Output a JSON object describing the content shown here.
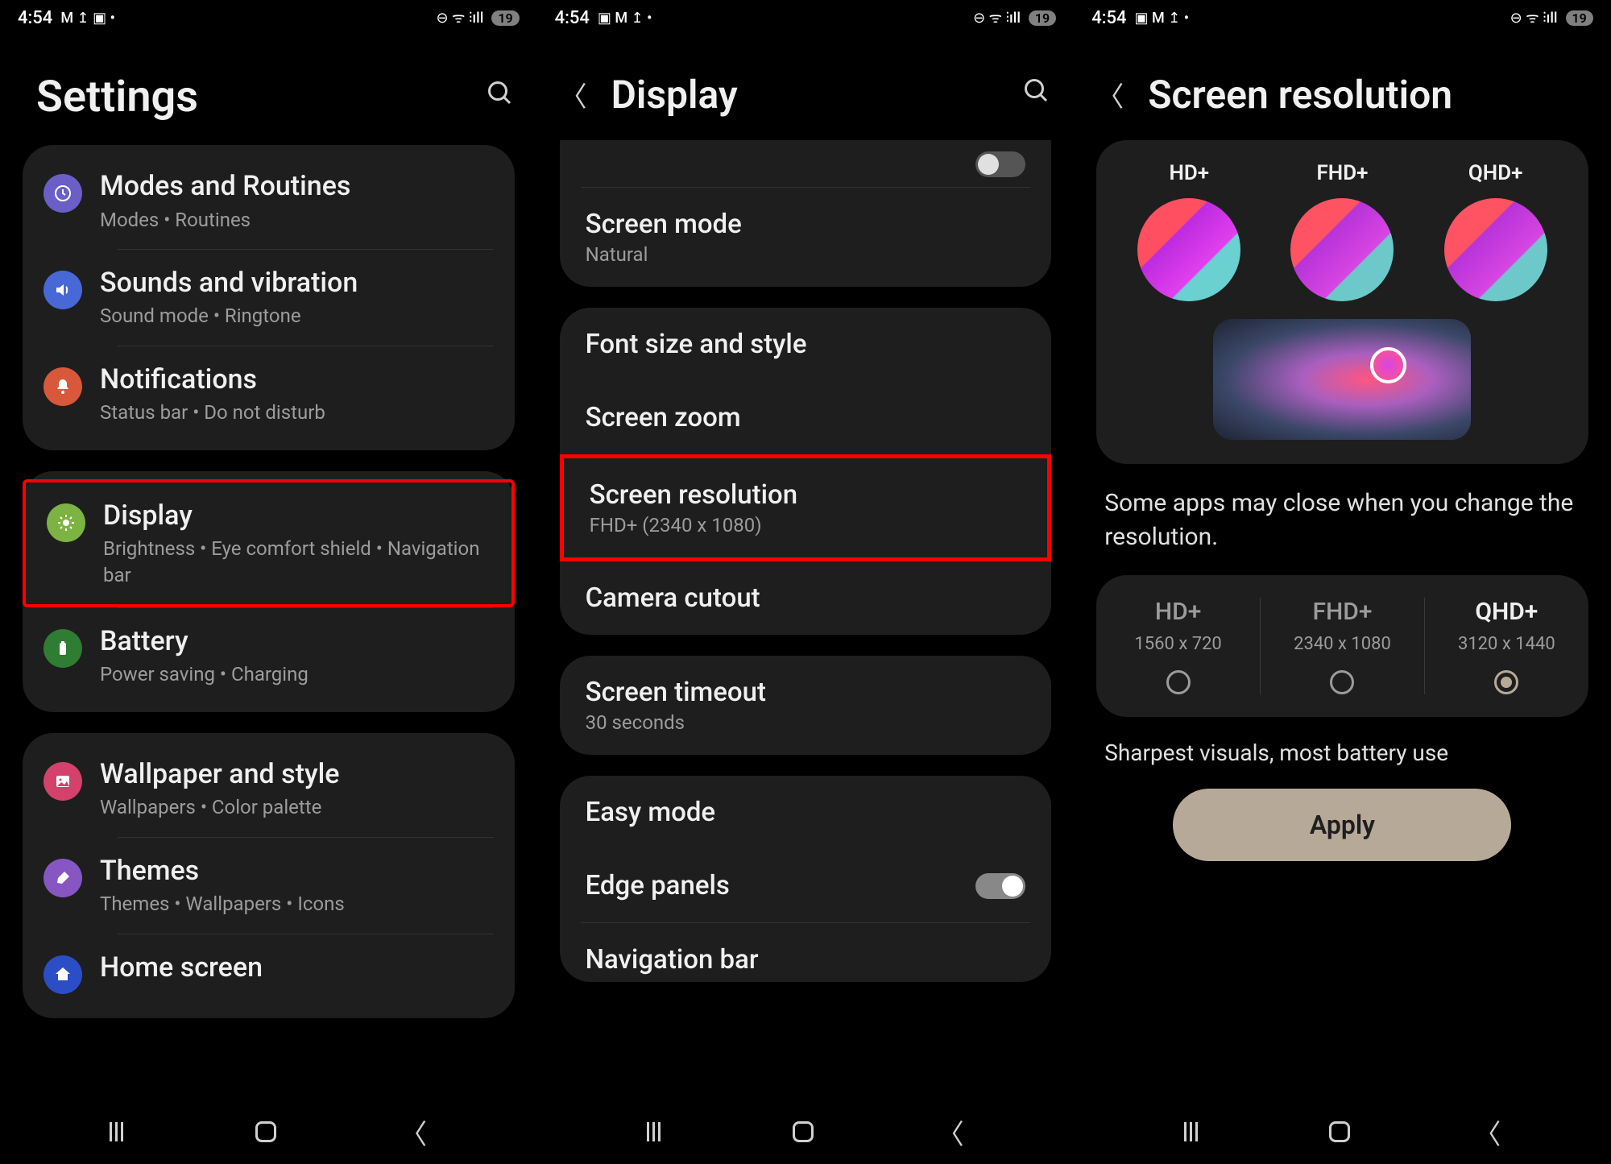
{
  "status_bar": {
    "time": "4:54",
    "battery": "19"
  },
  "screen1": {
    "title": "Settings",
    "groups": [
      {
        "items": [
          {
            "key": "modes",
            "title": "Modes and Routines",
            "sub": "Modes  •  Routines",
            "iconColor": "icon-purple",
            "icon": "clock-icon"
          },
          {
            "key": "sounds",
            "title": "Sounds and vibration",
            "sub": "Sound mode  •  Ringtone",
            "iconColor": "icon-blue",
            "icon": "volume-icon"
          },
          {
            "key": "notifications",
            "title": "Notifications",
            "sub": "Status bar  •  Do not disturb",
            "iconColor": "icon-orange",
            "icon": "bell-icon"
          }
        ]
      },
      {
        "items": [
          {
            "key": "display",
            "title": "Display",
            "sub": "Brightness  •  Eye comfort shield  •  Navigation bar",
            "iconColor": "icon-green",
            "icon": "sun-icon",
            "highlighted": true
          },
          {
            "key": "battery",
            "title": "Battery",
            "sub": "Power saving  •  Charging",
            "iconColor": "icon-darkgreen",
            "icon": "battery-icon"
          }
        ]
      },
      {
        "items": [
          {
            "key": "wallpaper",
            "title": "Wallpaper and style",
            "sub": "Wallpapers  •  Color palette",
            "iconColor": "icon-pink",
            "icon": "picture-icon"
          },
          {
            "key": "themes",
            "title": "Themes",
            "sub": "Themes  •  Wallpapers  •  Icons",
            "iconColor": "icon-purple2",
            "icon": "brush-icon"
          },
          {
            "key": "home",
            "title": "Home screen",
            "sub": "",
            "iconColor": "icon-navy",
            "icon": "home-icon"
          }
        ]
      }
    ]
  },
  "screen2": {
    "title": "Display",
    "group1": {
      "toggle_on": false,
      "screen_mode": {
        "title": "Screen mode",
        "sub": "Natural"
      }
    },
    "group2": {
      "font": "Font size and style",
      "zoom": "Screen zoom",
      "resolution": {
        "title": "Screen resolution",
        "sub": "FHD+ (2340 x 1080)"
      },
      "camera": "Camera cutout"
    },
    "group3": {
      "timeout": {
        "title": "Screen timeout",
        "sub": "30 seconds"
      }
    },
    "group4": {
      "easy": "Easy mode",
      "edge": "Edge panels",
      "edge_on": true,
      "nav": "Navigation bar"
    }
  },
  "screen3": {
    "title": "Screen resolution",
    "previews": [
      "HD+",
      "FHD+",
      "QHD+"
    ],
    "note": "Some apps may close when you change the resolution.",
    "options": [
      {
        "name": "HD+",
        "dim": "1560 x 720",
        "selected": false
      },
      {
        "name": "FHD+",
        "dim": "2340 x 1080",
        "selected": false
      },
      {
        "name": "QHD+",
        "dim": "3120 x 1440",
        "selected": true
      }
    ],
    "description": "Sharpest visuals, most battery use",
    "apply": "Apply"
  }
}
